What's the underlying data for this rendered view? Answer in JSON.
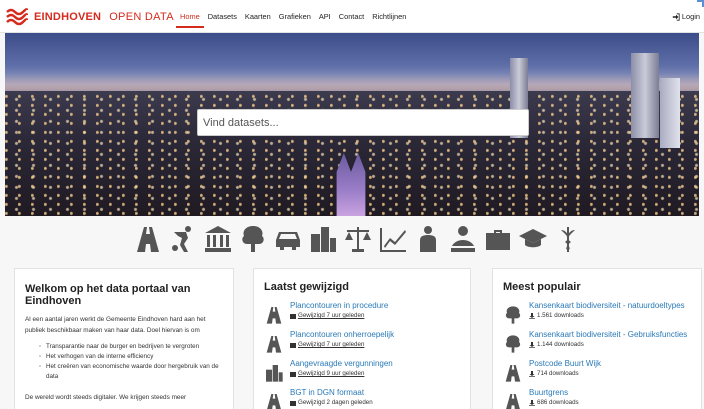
{
  "brand": {
    "name": "EINDHOVEN",
    "sub": "OPEN DATA",
    "color": "#d52b1e"
  },
  "nav": {
    "items": [
      {
        "label": "Home",
        "active": true
      },
      {
        "label": "Datasets"
      },
      {
        "label": "Kaarten"
      },
      {
        "label": "Grafieken"
      },
      {
        "label": "API"
      },
      {
        "label": "Contact"
      },
      {
        "label": "Richtlijnen"
      }
    ],
    "login": "Login"
  },
  "search": {
    "placeholder": "Vind datasets..."
  },
  "categories": [
    "road-icon",
    "sports-icon",
    "government-icon",
    "tree-icon",
    "car-icon",
    "building-icon",
    "scales-icon",
    "chart-icon",
    "worker-icon",
    "tourism-icon",
    "briefcase-icon",
    "graduation-icon",
    "health-icon"
  ],
  "welcome": {
    "title": "Welkom op het data portaal van Eindhoven",
    "intro": "Al een aantal jaren werkt de Gemeente Eindhoven hard aan het publiek beschikbaar maken van haar data. Doel hiervan is om",
    "bullets": [
      "Transparantie naar de burger en bedrijven te vergroten",
      "Het verhogen van de interne efficiency",
      "Het creëren van economische waarde door hergebruik van de data"
    ],
    "tail": "De wereld wordt steeds digitaler. We krijgen steeds meer"
  },
  "latest": {
    "title": "Laatst gewijzigd",
    "items": [
      {
        "title": "Plancontouren in procedure",
        "meta": "Gewijzigd 7 uur geleden",
        "icon": "road-icon"
      },
      {
        "title": "Plancontouren onherroepelijk",
        "meta": "Gewijzigd 7 uur geleden",
        "icon": "road-icon"
      },
      {
        "title": "Aangevraagde vergunningen",
        "meta": "Gewijzigd 9 uur geleden",
        "icon": "building-icon"
      },
      {
        "title": "BGT in DGN formaat",
        "meta": "Gewijzigd 2 dagen geleden",
        "icon": "road-icon"
      }
    ]
  },
  "popular": {
    "title": "Meest populair",
    "items": [
      {
        "title": "Kansenkaart biodiversiteit - natuurdoeltypes",
        "meta": "1.561 downloads",
        "icon": "tree-icon"
      },
      {
        "title": "Kansenkaart biodiversiteit - Gebruiksfuncties",
        "meta": "1.144 downloads",
        "icon": "tree-icon"
      },
      {
        "title": "Postcode Buurt Wijk",
        "meta": "714 downloads",
        "icon": "road-icon"
      },
      {
        "title": "Buurtgrens",
        "meta": "686 downloads",
        "icon": "road-icon"
      }
    ]
  }
}
